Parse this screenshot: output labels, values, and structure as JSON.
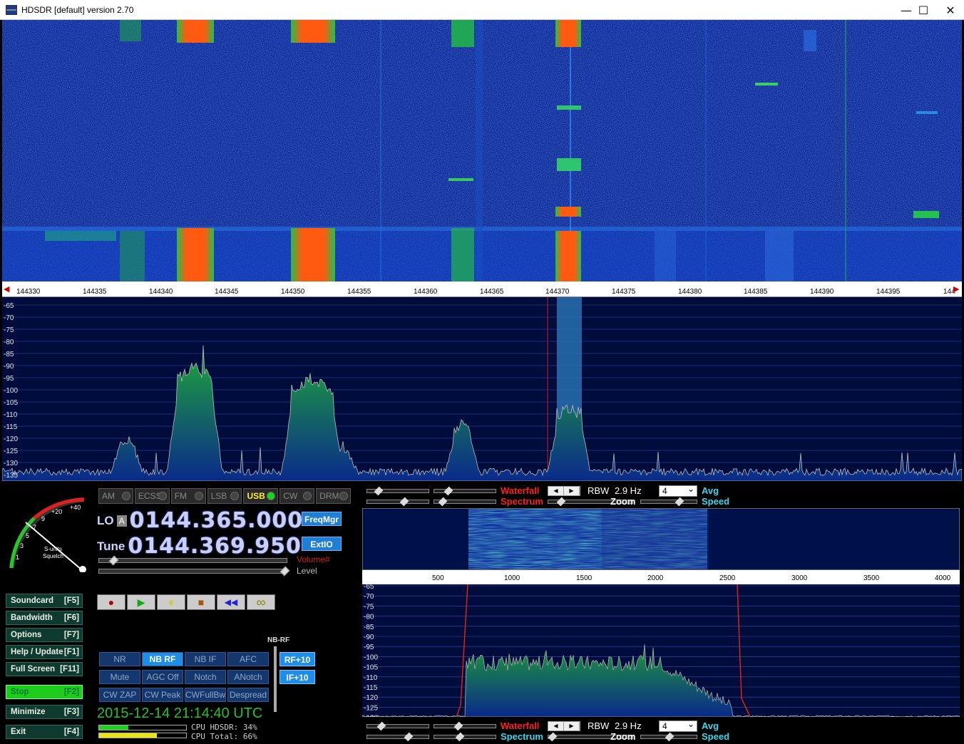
{
  "window": {
    "title": "HDSDR [default]  version 2.70",
    "controls": {
      "minimize": "—",
      "maximize": "☐",
      "close": "✕"
    }
  },
  "main_freq_axis": {
    "left_arrow": "◀",
    "right_arrow": "▶",
    "ticks": [
      "144330",
      "144335",
      "144340",
      "144345",
      "144350",
      "144355",
      "144360",
      "144365",
      "144370",
      "144375",
      "144380",
      "144385",
      "144390",
      "144395",
      "144"
    ]
  },
  "main_spectrum": {
    "db_labels": [
      "-65",
      "-70",
      "-75",
      "-80",
      "-85",
      "-90",
      "-95",
      "-100",
      "-105",
      "-110",
      "-115",
      "-120",
      "-125",
      "-130",
      "-135"
    ]
  },
  "smeter": {
    "scale": [
      "1",
      "3",
      "5",
      "7",
      "9",
      "+20",
      "+40"
    ],
    "caption1": "S-units",
    "caption2": "Squelch"
  },
  "modes": [
    {
      "label": "AM",
      "active": false
    },
    {
      "label": "ECSS",
      "active": false
    },
    {
      "label": "FM",
      "active": false
    },
    {
      "label": "LSB",
      "active": false
    },
    {
      "label": "USB",
      "active": true
    },
    {
      "label": "CW",
      "active": false
    },
    {
      "label": "DRM",
      "active": false
    }
  ],
  "lo": {
    "label": "LO",
    "ab": "A",
    "freq": "0144.365.000"
  },
  "tune": {
    "label": "Tune",
    "freq": "0144.369.950"
  },
  "buttons": {
    "freqmgr": "FreqMgr",
    "extio": "ExtIO",
    "rf10": "RF+10",
    "if10": "IF+10",
    "nbrf_caption": "NB-RF"
  },
  "volume": {
    "volume_label": "Volume#",
    "level_label": "Level"
  },
  "side_buttons": [
    {
      "label": "Soundcard",
      "key": "[F5]"
    },
    {
      "label": "Bandwidth",
      "key": "[F6]"
    },
    {
      "label": "Options",
      "key": "[F7]"
    },
    {
      "label": "Help / Update",
      "key": "[F1]"
    },
    {
      "label": "Full Screen",
      "key": "[F11]"
    },
    {
      "label": "Stop",
      "key": "[F2]"
    },
    {
      "label": "Minimize",
      "key": "[F3]"
    },
    {
      "label": "Exit",
      "key": "[F4]"
    }
  ],
  "transport": {
    "record": "●",
    "play": "▶",
    "pause": "⏸",
    "stop": "■",
    "rewind": "◀◀",
    "loop": "∞"
  },
  "dsp": [
    {
      "label": "NR",
      "on": false
    },
    {
      "label": "NB RF",
      "on": true
    },
    {
      "label": "NB IF",
      "on": false
    },
    {
      "label": "AFC",
      "on": false
    },
    {
      "label": "Mute",
      "on": false
    },
    {
      "label": "AGC Off",
      "on": false
    },
    {
      "label": "Notch",
      "on": false
    },
    {
      "label": "ANotch",
      "on": false
    },
    {
      "label": "CW ZAP",
      "on": false
    },
    {
      "label": "CW Peak",
      "on": false
    },
    {
      "label": "CWFullBw",
      "on": false
    },
    {
      "label": "Despread",
      "on": false
    }
  ],
  "clock": "2015-12-14   21:14:40 UTC",
  "cpu": {
    "hdsdr_label": "CPU HDSDR: 34%",
    "total_label": "CPU Total: 66%",
    "hdsdr_pct": 34,
    "total_pct": 66
  },
  "zoom_controls": {
    "top": {
      "waterfall": "Waterfall",
      "spectrum": "Spectrum",
      "rbw_label": "RBW",
      "rbw_value": "2.9 Hz",
      "zoom": "Zoom",
      "avg_value": "4",
      "avg": "Avg",
      "speed": "Speed"
    },
    "bottom": {
      "waterfall": "Waterfall",
      "spectrum": "Spectrum",
      "rbw_label": "RBW",
      "rbw_value": "2.9 Hz",
      "zoom": "Zoom",
      "avg_value": "4",
      "avg": "Avg",
      "speed": "Speed"
    }
  },
  "zoom_axis": {
    "ticks": [
      "500",
      "1000",
      "1500",
      "2000",
      "2500",
      "3000",
      "3500",
      "4000"
    ]
  },
  "zoom_spectrum": {
    "db_labels": [
      "-65",
      "-70",
      "-75",
      "-80",
      "-85",
      "-90",
      "-95",
      "-100",
      "-105",
      "-110",
      "-115",
      "-120",
      "-125",
      "-130"
    ]
  },
  "colors": {
    "accent_blue": "#1f8ee8",
    "green_led": "#1bd41b",
    "waterfall_bg": "#0a1a8a",
    "signal_red": "#ff4a0a",
    "clock_green": "#22c22a"
  }
}
